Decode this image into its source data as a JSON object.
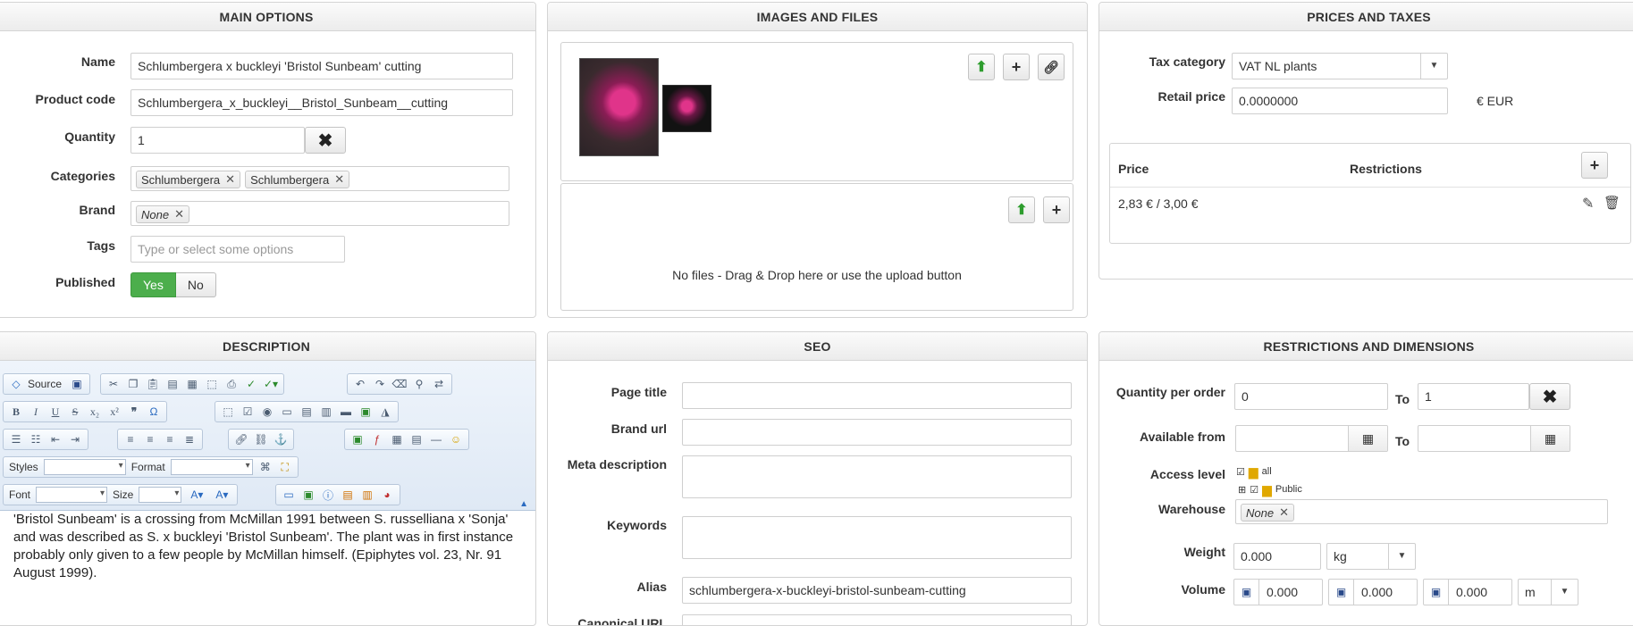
{
  "main_options": {
    "title": "MAIN OPTIONS",
    "name_label": "Name",
    "name_value": "Schlumbergera x buckleyi 'Bristol Sunbeam' cutting",
    "code_label": "Product code",
    "code_value": "Schlumbergera_x_buckleyi__Bristol_Sunbeam__cutting",
    "qty_label": "Quantity",
    "qty_value": "1",
    "categories_label": "Categories",
    "categories": [
      "Schlumbergera",
      "Schlumbergera"
    ],
    "brand_label": "Brand",
    "brand_value": "None",
    "tags_label": "Tags",
    "tags_placeholder": "Type or select some options",
    "published_label": "Published",
    "yes": "Yes",
    "no": "No"
  },
  "images": {
    "title": "IMAGES AND FILES",
    "no_files": "No files - Drag & Drop here or use the upload button"
  },
  "prices": {
    "title": "PRICES AND TAXES",
    "tax_label": "Tax category",
    "tax_value": "VAT NL plants",
    "retail_label": "Retail price",
    "retail_value": "0.0000000",
    "currency": "€ EUR",
    "col_price": "Price",
    "col_restrictions": "Restrictions",
    "row_price": "2,83 € / 3,00 €"
  },
  "description": {
    "title": "DESCRIPTION",
    "source_label": "Source",
    "styles_label": "Styles",
    "format_label": "Format",
    "font_label": "Font",
    "size_label": "Size",
    "text": "'Bristol Sunbeam' is a crossing from McMillan 1991 between S. russelliana x  'Sonja' and was described as S. x buckleyi 'Bristol Sunbeam'. The plant was in first instance probably only given to a few people by McMillan himself. (Epiphytes vol. 23, Nr. 91 August 1999)."
  },
  "seo": {
    "title": "SEO",
    "page_title_label": "Page title",
    "brand_url_label": "Brand url",
    "meta_label": "Meta description",
    "keywords_label": "Keywords",
    "alias_label": "Alias",
    "alias_value": "schlumbergera-x-buckleyi-bristol-sunbeam-cutting",
    "canonical_label": "Canonical URL"
  },
  "restrictions": {
    "title": "RESTRICTIONS AND DIMENSIONS",
    "qpo_label": "Quantity per order",
    "qpo_from": "0",
    "to": "To",
    "qpo_to": "1",
    "available_label": "Available from",
    "access_label": "Access level",
    "access_all": "all",
    "access_public": "Public",
    "warehouse_label": "Warehouse",
    "warehouse_value": "None",
    "weight_label": "Weight",
    "weight_value": "0.000",
    "weight_unit": "kg",
    "volume_label": "Volume",
    "vol1": "0.000",
    "vol2": "0.000",
    "vol3": "0.000",
    "vol_unit": "m"
  },
  "colors": {
    "published_on": "#4cae4c",
    "upload": "#2e9d2e"
  }
}
